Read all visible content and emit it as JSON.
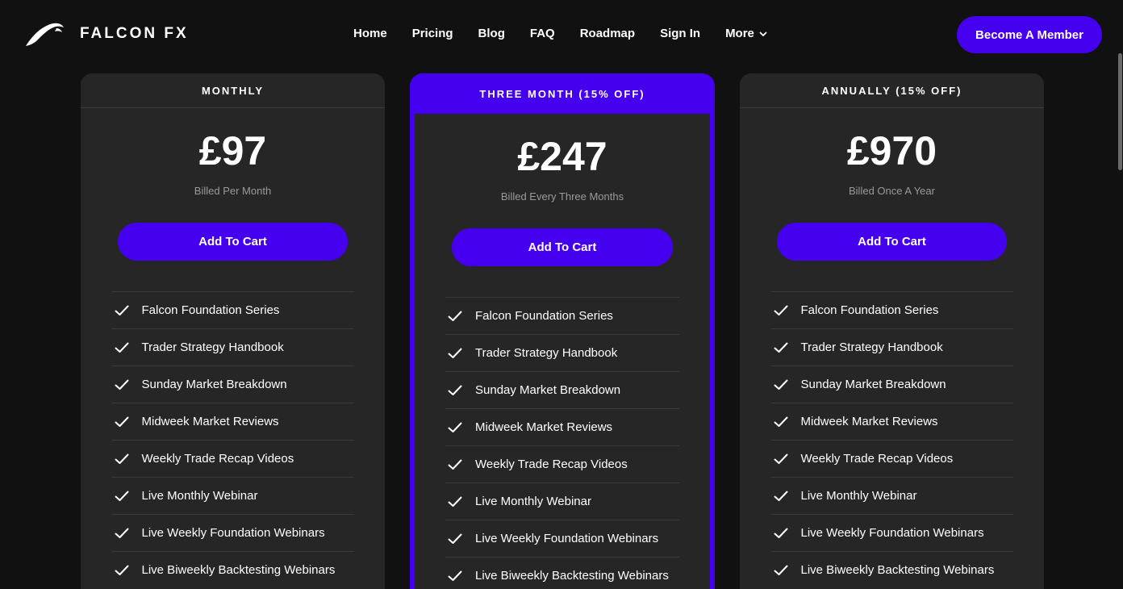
{
  "brand": {
    "name": "FALCON FX",
    "logo_icon": "falcon-wing-logo"
  },
  "nav": {
    "items": [
      "Home",
      "Pricing",
      "Blog",
      "FAQ",
      "Roadmap",
      "Sign In"
    ],
    "more_label": "More",
    "more_icon": "chevron-down-icon"
  },
  "header": {
    "cta_label": "Become A Member"
  },
  "colors": {
    "accent": "#4600f0",
    "background": "#111111",
    "card": "#262626"
  },
  "plans": [
    {
      "title": "MONTHLY",
      "price": "£97",
      "billing": "Billed Per Month",
      "button_label": "Add To Cart",
      "featured": false,
      "features": [
        "Falcon Foundation Series",
        "Trader Strategy Handbook",
        "Sunday Market Breakdown",
        "Midweek Market Reviews",
        "Weekly Trade Recap Videos",
        "Live Monthly Webinar",
        "Live Weekly Foundation Webinars",
        "Live Biweekly Backtesting Webinars"
      ]
    },
    {
      "title": "THREE MONTH (15% OFF)",
      "price": "£247",
      "billing": "Billed Every Three Months",
      "button_label": "Add To Cart",
      "featured": true,
      "features": [
        "Falcon Foundation Series",
        "Trader Strategy Handbook",
        "Sunday Market Breakdown",
        "Midweek Market Reviews",
        "Weekly Trade Recap Videos",
        "Live Monthly Webinar",
        "Live Weekly Foundation Webinars",
        "Live Biweekly Backtesting Webinars"
      ]
    },
    {
      "title": "ANNUALLY (15% OFF)",
      "price": "£970",
      "billing": "Billed Once A Year",
      "button_label": "Add To Cart",
      "featured": false,
      "features": [
        "Falcon Foundation Series",
        "Trader Strategy Handbook",
        "Sunday Market Breakdown",
        "Midweek Market Reviews",
        "Weekly Trade Recap Videos",
        "Live Monthly Webinar",
        "Live Weekly Foundation Webinars",
        "Live Biweekly Backtesting Webinars"
      ]
    }
  ]
}
